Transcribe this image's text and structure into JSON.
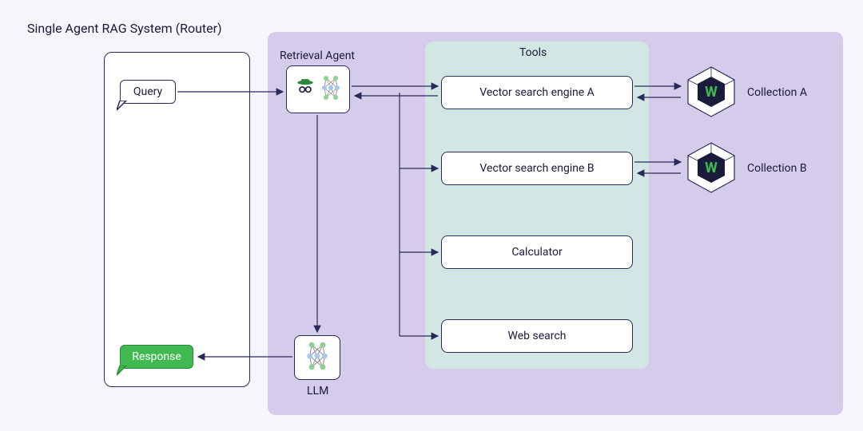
{
  "title": "Single Agent RAG System (Router)",
  "query_label": "Query",
  "response_label": "Response",
  "retrieval_agent_label": "Retrieval Agent",
  "llm_label": "LLM",
  "tools_label": "Tools",
  "tools": {
    "a": "Vector search engine A",
    "b": "Vector search engine B",
    "calc": "Calculator",
    "web": "Web search"
  },
  "collection_a": "Collection A",
  "collection_b": "Collection B",
  "colors": {
    "bg": "#f5f6fb",
    "purple_panel": "#d5cceb",
    "teal_panel": "#d2e7e3",
    "stroke": "#2a2a5a",
    "green": "#3fb950"
  }
}
